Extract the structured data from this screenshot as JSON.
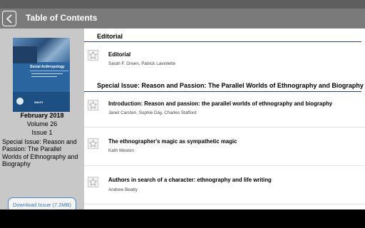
{
  "header": {
    "title": "Table of Contents",
    "back_icon": "chevron-left-icon"
  },
  "issue": {
    "cover_title": "Social Anthropology",
    "cover_publisher": "WILEY",
    "date": "February 2018",
    "volume": "Volume 26",
    "number": "Issue 1",
    "description": "Special Issue: Reason and Passion: The Parallel Worlds of Ethnography and Biography",
    "download_label": "Download Issue (7.2MB)"
  },
  "sections": [
    {
      "title": "Editorial",
      "articles": [
        {
          "title": "Editorial",
          "authors": "Sarah F. Green, Patrick Laviolette"
        }
      ]
    },
    {
      "title": "Special Issue: Reason and Passion: The Parallel Worlds of Ethnography and Biography",
      "articles": [
        {
          "title": "Introduction: Reason and passion: the parallel worlds of ethnography and biography",
          "authors": "Janet Carsten, Sophie Day, Charles Stafford"
        },
        {
          "title": "The ethnographer's magic as sympathetic magic",
          "authors": "Kath Weston"
        },
        {
          "title": "Authors in search of a character: ethnography and life writing",
          "authors": "Andrew Beatty"
        }
      ]
    }
  ],
  "colors": {
    "app_bar": "#7a7a7a",
    "sidebar": "#c8c8c8",
    "accent": "#3d79be",
    "section_rule": "#2e3f7a"
  }
}
